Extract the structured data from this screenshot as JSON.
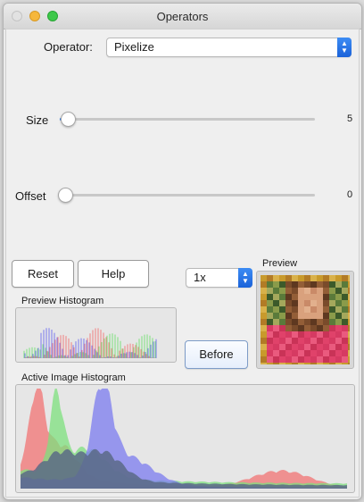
{
  "window": {
    "title": "Operators"
  },
  "operator": {
    "label": "Operator:",
    "selected": "Pixelize"
  },
  "size": {
    "label": "Size",
    "value": "5",
    "level": 0.0
  },
  "offset": {
    "label": "Offset",
    "value": "0",
    "level": 0.0
  },
  "buttons": {
    "reset": "Reset",
    "help": "Help",
    "before": "Before"
  },
  "zoom": {
    "selected": "1x"
  },
  "preview": {
    "label": "Preview"
  },
  "preview_histogram": {
    "label": "Preview Histogram"
  },
  "active_histogram": {
    "label": "Active Image Histogram"
  },
  "colors": {
    "accent": "#2f7ff0",
    "red_channel": "#f08080",
    "green_channel": "#7ee07e",
    "blue_channel": "#7b7bef",
    "luminance": "#5a6a86"
  }
}
